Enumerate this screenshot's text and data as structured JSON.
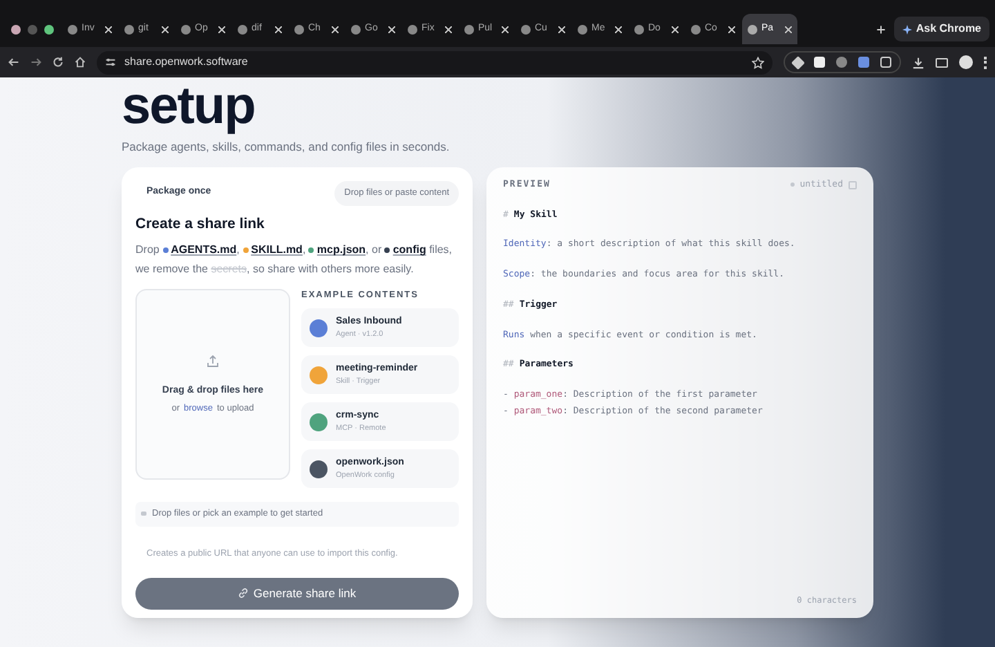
{
  "browser": {
    "tabs": [
      {
        "label": "Inv",
        "selected": false
      },
      {
        "label": "git",
        "selected": false
      },
      {
        "label": "Op",
        "selected": false
      },
      {
        "label": "dif",
        "selected": false
      },
      {
        "label": "Ch",
        "selected": false
      },
      {
        "label": "Go",
        "selected": false
      },
      {
        "label": "Fix",
        "selected": false
      },
      {
        "label": "Pul",
        "selected": false
      },
      {
        "label": "Cu",
        "selected": false
      },
      {
        "label": "Me",
        "selected": false
      },
      {
        "label": "Do",
        "selected": false
      },
      {
        "label": "Co",
        "selected": false
      },
      {
        "label": "Pa",
        "selected": true
      }
    ],
    "ask_button": "Ask Chrome",
    "url": "share.openwork.software"
  },
  "hero": {
    "title": "setup",
    "subtitle": "Package agents, skills, commands, and config files in seconds."
  },
  "share_card": {
    "eyebrow": "Package once",
    "hint_pill": "Drop files or paste content",
    "heading": "Create a share link",
    "intro": [
      {
        "kind": "plain",
        "text": "Drop"
      },
      {
        "kind": "file",
        "text": "AGENTS.md",
        "color": "#5b7fd6"
      },
      {
        "kind": "plain",
        "text": ","
      },
      {
        "kind": "file",
        "text": "SKILL.md",
        "color": "#f0a43a"
      },
      {
        "kind": "plain",
        "text": ","
      },
      {
        "kind": "file",
        "text": "mcp.json",
        "color": "#4fa37e"
      },
      {
        "kind": "plain",
        "text": ", or"
      },
      {
        "kind": "file",
        "text": "config",
        "color": "#374151"
      },
      {
        "kind": "plain",
        "text": "files, we remove the"
      },
      {
        "kind": "strike",
        "text": "secrets"
      },
      {
        "kind": "plain",
        "text": ", so share with others more easily."
      }
    ],
    "dropzone": {
      "title": "Drag & drop files here",
      "before": "or",
      "link": "browse",
      "after": "to upload"
    },
    "examples_heading": "EXAMPLE CONTENTS",
    "examples": [
      {
        "name": "Sales Inbound",
        "meta": "Agent · v1.2.0",
        "color": "#5b7fd6"
      },
      {
        "name": "meeting-reminder",
        "meta": "Skill · Trigger",
        "color": "#f0a43a"
      },
      {
        "name": "crm-sync",
        "meta": "MCP · Remote",
        "color": "#4fa37e"
      },
      {
        "name": "openwork.json",
        "meta": "OpenWork config",
        "color": "#4b5563"
      }
    ],
    "status": "Drop files or pick an example to get started",
    "note": "Creates a public URL that anyone can use to import this config.",
    "button": "Generate share link"
  },
  "preview": {
    "label": "PREVIEW",
    "filename": "untitled",
    "char_count": "0 characters",
    "lines": [
      {
        "kind": "heading",
        "marker": "#",
        "text": "My Skill"
      },
      {
        "kind": "field",
        "key": "Identity",
        "text": ": a short description of what this skill does."
      },
      {
        "kind": "field",
        "key": "Scope",
        "text": ": the boundaries and focus area for this skill."
      },
      {
        "kind": "heading",
        "marker": "##",
        "text": "Trigger"
      },
      {
        "kind": "field",
        "key": "Runs",
        "text": " when a specific event or condition is met."
      },
      {
        "kind": "heading",
        "marker": "##",
        "text": "Parameters"
      },
      {
        "kind": "param",
        "marker": "-",
        "key": "param_one",
        "text": ": Description of the first parameter"
      },
      {
        "kind": "param",
        "marker": "-",
        "key": "param_two",
        "text": ": Description of the second parameter"
      }
    ]
  }
}
